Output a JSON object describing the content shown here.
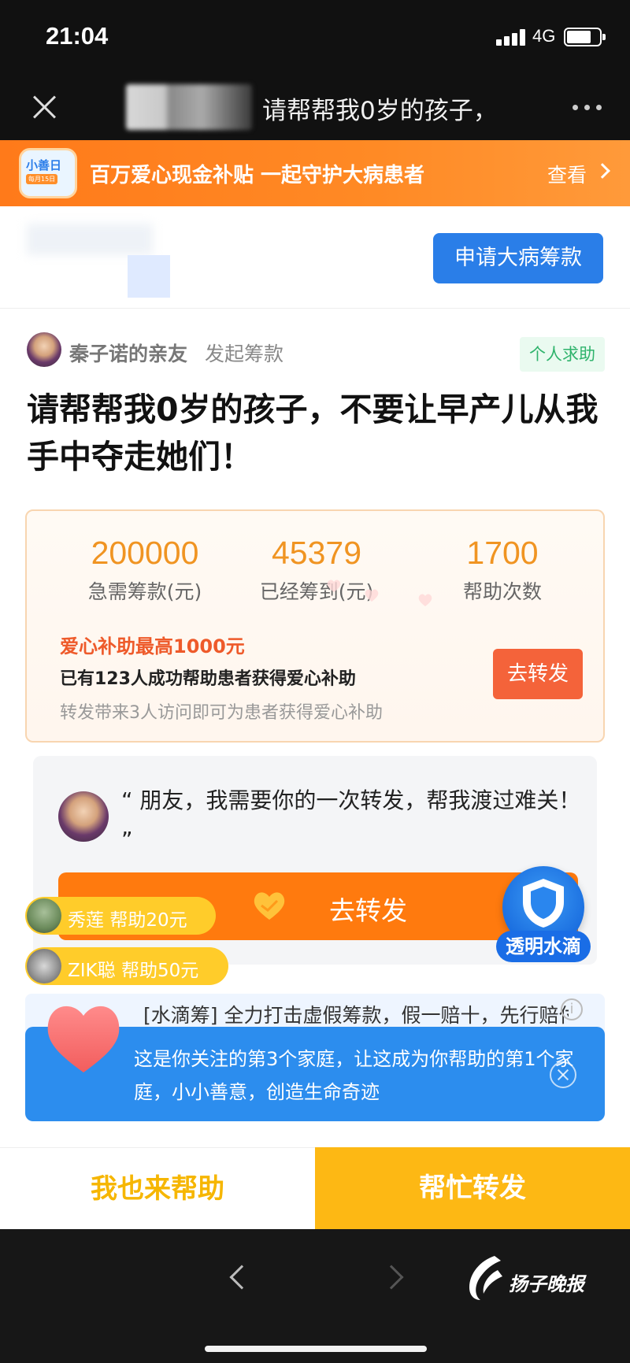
{
  "status": {
    "time": "21:04",
    "network": "4G"
  },
  "nav": {
    "title": "请帮帮我0岁的孩子，"
  },
  "promo": {
    "badge_top": "小善日",
    "badge_bottom": "每月15日",
    "text": "百万爱心现金补贴 一起守护大病患者",
    "view_label": "查看"
  },
  "apply": {
    "button_label": "申请大病筹款"
  },
  "initiator": {
    "name": "秦子诺的亲友",
    "action": "发起筹款",
    "tag": "个人求助"
  },
  "headline": "请帮帮我0岁的孩子，不要让早产儿从我手中夺走她们！",
  "stats": [
    {
      "value": "200000",
      "label": "急需筹款(元)"
    },
    {
      "value": "45379",
      "label": "已经筹到(元)"
    },
    {
      "value": "1700",
      "label": "帮助次数"
    }
  ],
  "subsidy": {
    "title": "爱心补助最高1000元",
    "line": "已有123人成功帮助患者获得爱心补助",
    "note": "转发带来3人访问即可为患者获得爱心补助",
    "share_label": "去转发"
  },
  "quote": {
    "text": "“ 朋友，我需要你的一次转发，帮我渡过难关！ ”",
    "share_label": "去转发"
  },
  "donors": [
    {
      "name": "秀莲",
      "text": "帮助20元"
    },
    {
      "name": "ZIK聪",
      "text": "帮助50元"
    }
  ],
  "shield": {
    "label": "透明水滴"
  },
  "notice": {
    "text": "[水滴筹] 全力打击虚假筹款，假一赔十，先行赔付"
  },
  "tip": {
    "text": "这是你关注的第3个家庭，让这成为你帮助的第1个家庭，小小善意，创造生命奇迹"
  },
  "actions": {
    "help_label": "我也来帮助",
    "share_label": "帮忙转发"
  },
  "logo": {
    "text": "扬子晚报"
  },
  "colors": {
    "accent_orange": "#ff7a0e",
    "brand_blue": "#2a7ee8",
    "stat_orange": "#f09422",
    "action_yellow": "#fdb814"
  }
}
